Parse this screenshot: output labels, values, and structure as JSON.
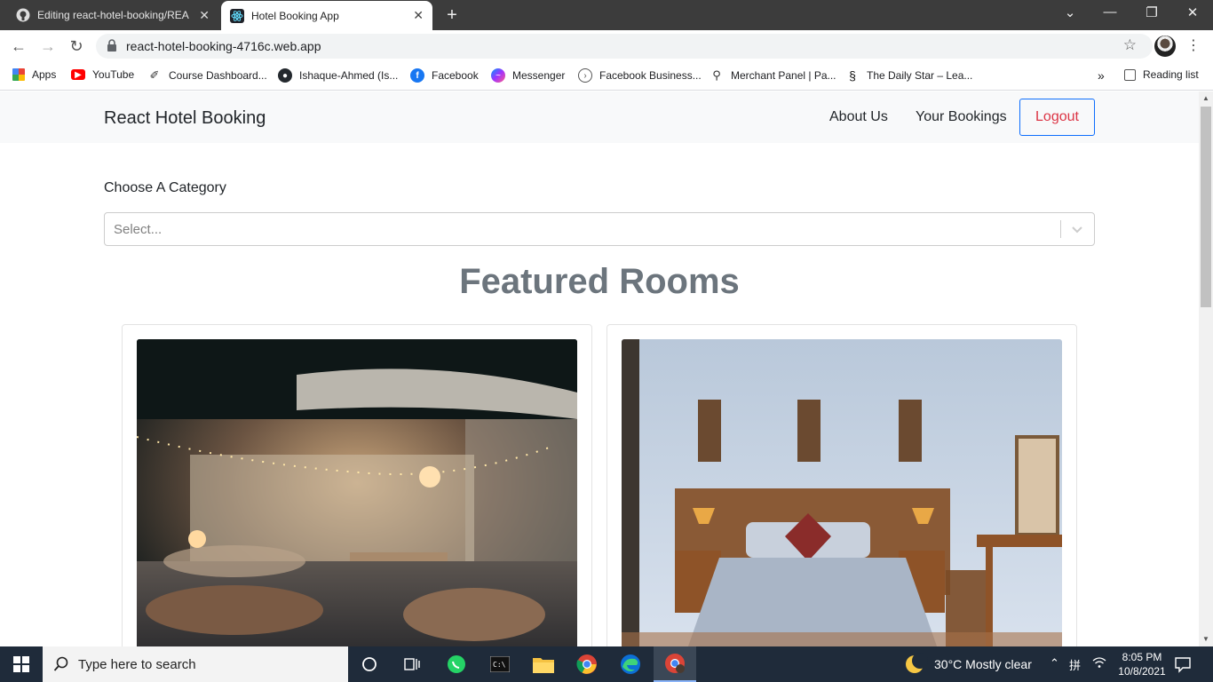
{
  "browser": {
    "tabs": [
      {
        "title": "Editing react-hotel-booking/REA",
        "icon": "github-icon",
        "active": false
      },
      {
        "title": "Hotel Booking App",
        "icon": "react-icon",
        "active": true
      }
    ],
    "url": "react-hotel-booking-4716c.web.app",
    "bookmarks": [
      {
        "label": "Apps",
        "icon": "apps-grid-icon"
      },
      {
        "label": "YouTube",
        "icon": "youtube-icon"
      },
      {
        "label": "Course Dashboard...",
        "icon": "course-icon"
      },
      {
        "label": "Ishaque-Ahmed (Is...",
        "icon": "github-icon"
      },
      {
        "label": "Facebook",
        "icon": "facebook-icon"
      },
      {
        "label": "Messenger",
        "icon": "messenger-icon"
      },
      {
        "label": "Facebook Business...",
        "icon": "business-icon"
      },
      {
        "label": "Merchant Panel | Pa...",
        "icon": "bicycle-icon"
      },
      {
        "label": "The Daily Star – Lea...",
        "icon": "daily-star-icon"
      }
    ],
    "more_bookmarks": "»",
    "reading_list": "Reading list"
  },
  "app": {
    "brand": "React Hotel Booking",
    "nav": {
      "about": "About Us",
      "bookings": "Your Bookings",
      "logout": "Logout"
    },
    "category_label": "Choose A Category",
    "select_placeholder": "Select...",
    "featured_title": "Featured Rooms",
    "rooms": [
      {
        "image": "outdoor-patio-night-photo"
      },
      {
        "image": "bedroom-photo"
      }
    ]
  },
  "taskbar": {
    "search_placeholder": "Type here to search",
    "weather": "30°C  Mostly clear",
    "time": "8:05 PM",
    "date": "10/8/2021"
  },
  "colors": {
    "primary": "#0d6efd",
    "danger": "#dc3545",
    "muted": "#6c757d",
    "navbar_bg": "#f8f9fa"
  }
}
